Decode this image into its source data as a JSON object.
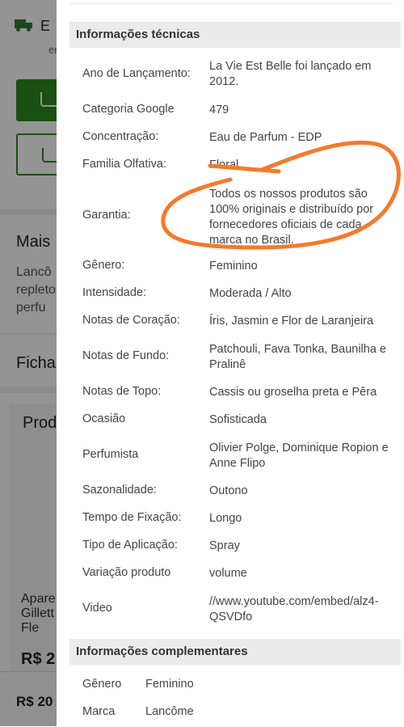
{
  "background": {
    "shipping_text": "E",
    "shipping_sub": "er",
    "mais_title": "Mais",
    "lanc_text": [
      "Lancô",
      "repleto",
      "perfu"
    ],
    "ficha_title": "Ficha",
    "products_title": "Prod",
    "product_name": [
      "Apare",
      "Gillett",
      "Fle"
    ],
    "product_price": "R$ 2",
    "bottom_price": "R$ 20"
  },
  "panel": {
    "tech_title": "Informações técnicas",
    "specs": [
      {
        "key": "Ano de Lançamento:",
        "value": "La Vie Est Belle foi lançado em 2012."
      },
      {
        "key": "Categoria Google",
        "value": "479"
      },
      {
        "key": "Concentração:",
        "value": "Eau de Parfum - EDP"
      },
      {
        "key": "Familia Olfativa:",
        "value": "Floral"
      },
      {
        "key": "Garantia:",
        "value": "Todos os nossos produtos são 100% originais e distribuído por fornecedores oficiais de cada marca no Brasil."
      },
      {
        "key": "Gênero:",
        "value": "Feminino"
      },
      {
        "key": "Intensidade:",
        "value": "Moderada / Alto"
      },
      {
        "key": "Notas de Coração:",
        "value": "Íris, Jasmin e Flor de Laranjeira"
      },
      {
        "key": "Notas de Fundo:",
        "value": "Patchouli, Fava Tonka, Baunilha e Pralinê"
      },
      {
        "key": "Notas de Topo:",
        "value": "Cassis ou groselha preta e Pêra"
      },
      {
        "key": "Ocasião",
        "value": "Sofisticada"
      },
      {
        "key": "Perfumista",
        "value": "Olivier Polge, Dominique Ropion e Anne Flipo"
      },
      {
        "key": "Sazonalidade:",
        "value": "Outono"
      },
      {
        "key": "Tempo de Fixação:",
        "value": "Longo"
      },
      {
        "key": "Tipo de Aplicação:",
        "value": "Spray"
      },
      {
        "key": "Variação produto",
        "value": "volume"
      },
      {
        "key": "Video",
        "value": "//www.youtube.com/embed/alz4-QSVDfo"
      }
    ],
    "comp_title": "Informações complementares",
    "comp": [
      {
        "key": "Gênero",
        "value": "Feminino"
      },
      {
        "key": "Marca",
        "value": "Lancôme"
      }
    ]
  },
  "colors": {
    "accent_green": "#2e8b1e",
    "annotation": "#f47a2a"
  }
}
